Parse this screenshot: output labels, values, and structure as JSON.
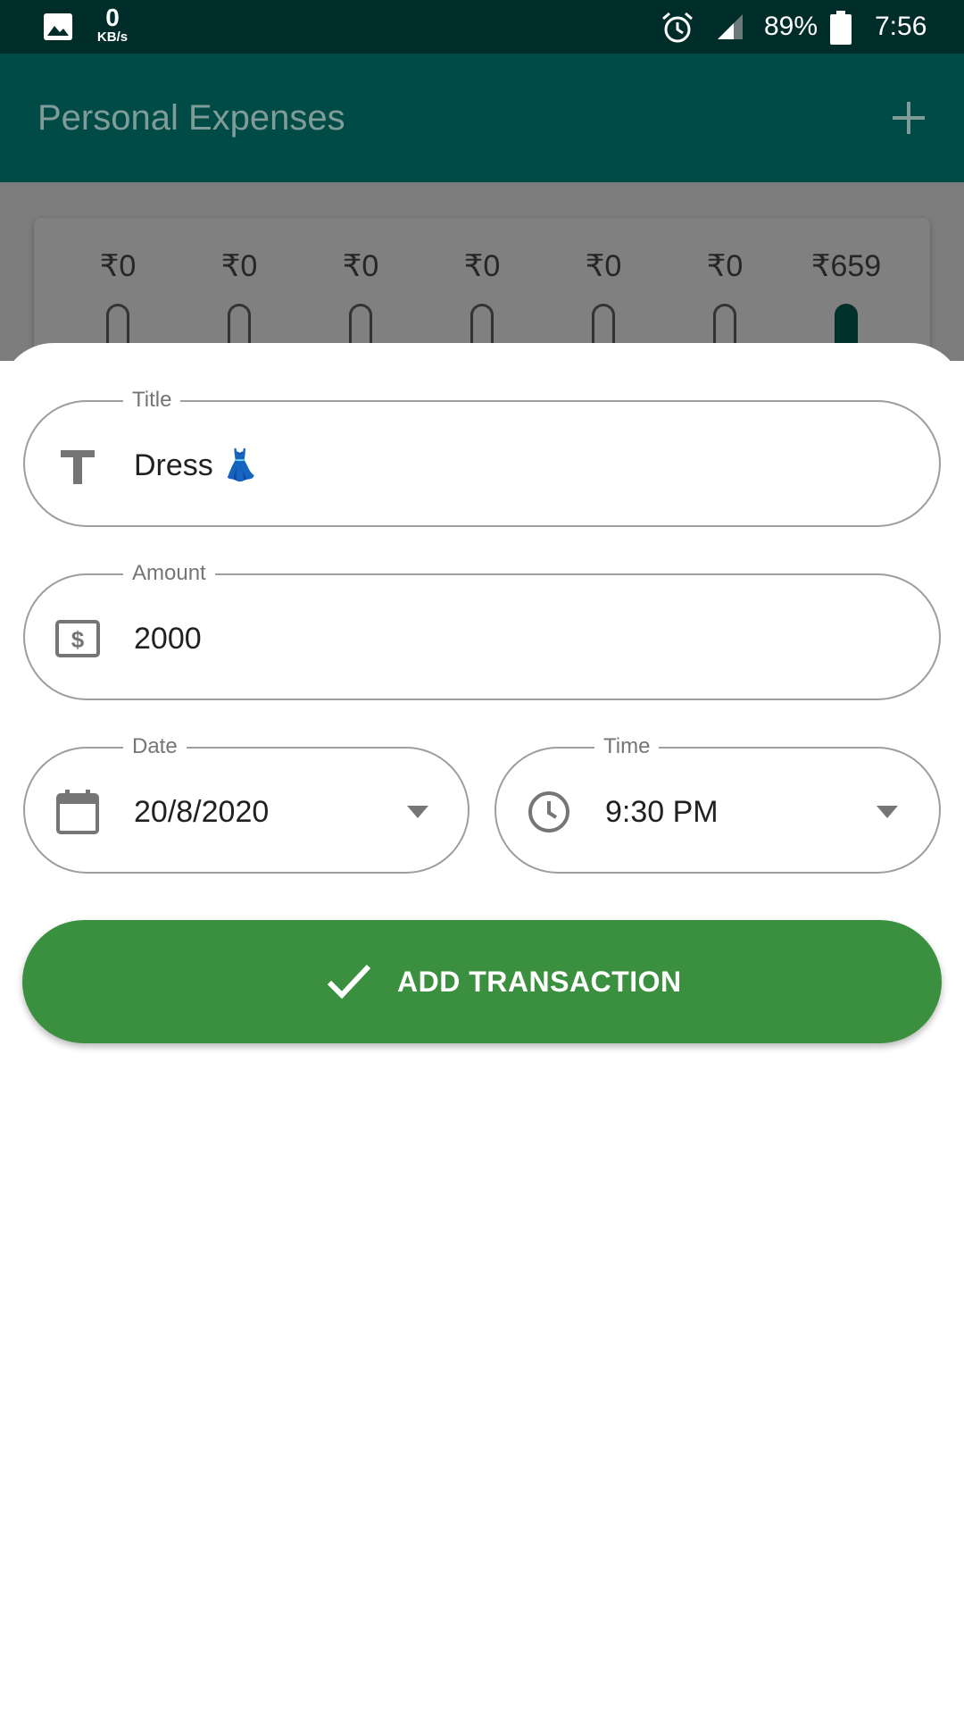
{
  "status_bar": {
    "speed_value": "0",
    "speed_unit": "KB/s",
    "battery": "89%",
    "time": "7:56"
  },
  "app_bar": {
    "title": "Personal Expenses",
    "add_icon": "plus-icon"
  },
  "weekly_chart": {
    "amounts": [
      "₹0",
      "₹0",
      "₹0",
      "₹0",
      "₹0",
      "₹0",
      "₹659"
    ],
    "fill_fractions": [
      0,
      0,
      0,
      0,
      0,
      0,
      1
    ]
  },
  "form": {
    "title": {
      "label": "Title",
      "value": "Dress 👗",
      "icon": "text-icon"
    },
    "amount": {
      "label": "Amount",
      "value": "2000",
      "icon": "money-icon"
    },
    "date": {
      "label": "Date",
      "value": "20/8/2020",
      "icon": "calendar-icon"
    },
    "time": {
      "label": "Time",
      "value": "9:30 PM",
      "icon": "clock-icon"
    },
    "submit_label": "ADD TRANSACTION"
  },
  "colors": {
    "primary": "#004b45",
    "status_bar": "#002d2a",
    "button": "#3a903e"
  }
}
